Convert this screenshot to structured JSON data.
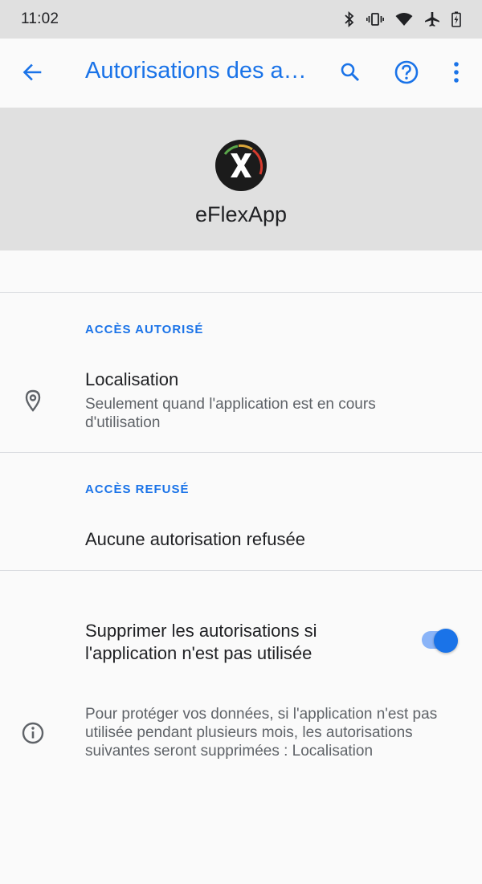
{
  "status_bar": {
    "time": "11:02",
    "icons": [
      "bluetooth-icon",
      "vibrate-icon",
      "wifi-icon",
      "airplane-icon",
      "battery-icon"
    ]
  },
  "app_bar": {
    "title": "Autorisations des a…",
    "accent_color": "#1a73e8",
    "icons": [
      "back-arrow-icon",
      "search-icon",
      "help-icon",
      "more-vert-icon"
    ]
  },
  "app_header": {
    "name": "eFlexApp",
    "icon": "eflex-app-icon"
  },
  "allowed_section": {
    "title": "ACCÈS AUTORISÉ",
    "items": [
      {
        "icon": "location-pin-icon",
        "title": "Localisation",
        "summary": "Seulement quand l'application est en cours d'utilisation"
      }
    ]
  },
  "denied_section": {
    "title": "ACCÈS REFUSÉ",
    "empty_text": "Aucune autorisation refusée"
  },
  "unused_apps": {
    "toggle_label": "Supprimer les autorisations si l'application n'est pas utilisée",
    "toggle_on": true,
    "info_icon": "info-icon",
    "info_text": "Pour protéger vos données, si l'application n'est pas utilisée pendant plusieurs mois, les autorisations suivantes seront supprimées : Localisation"
  }
}
